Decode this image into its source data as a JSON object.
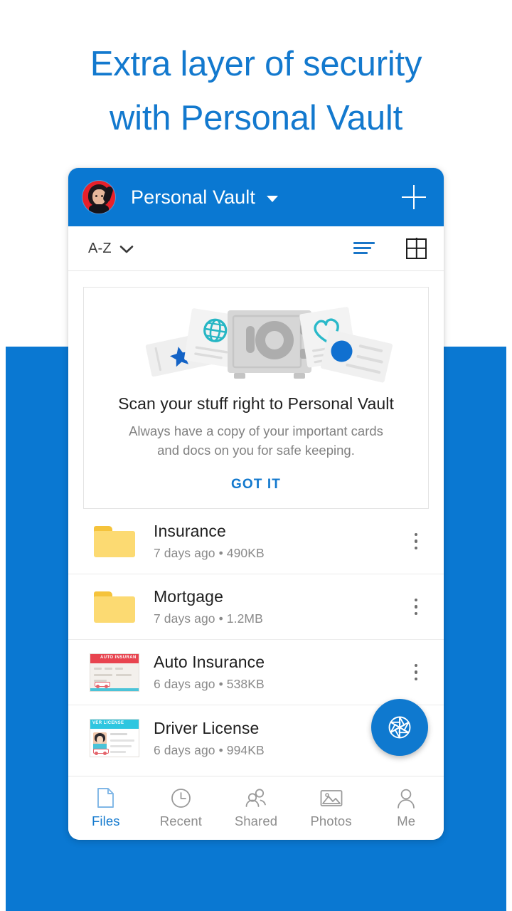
{
  "promo_banner": {
    "headline": "Extra layer of security\nwith Personal Vault",
    "headline_color": "#1379ce",
    "background_color": "#0a78d2"
  },
  "app": {
    "appbar": {
      "title": "Personal Vault",
      "avatar_name": "user-avatar",
      "dropdown_icon": "chevron-down-icon",
      "add_icon": "plus-icon",
      "background_color": "#0a78d2"
    },
    "sortbar": {
      "sort_label": "A-Z",
      "sort_caret_icon": "chevron-down-icon",
      "list_view_icon": "list-view-icon",
      "grid_view_icon": "grid-view-icon",
      "active_view": "list",
      "active_color": "#1a76c8"
    },
    "promo_card": {
      "title": "Scan your stuff right to Personal Vault",
      "subtitle": "Always have a copy of your important cards\nand docs on you for safe keeping.",
      "action_label": "GOT IT",
      "action_color": "#1379ce",
      "illustration": {
        "name": "personal-vault-safe-illustration",
        "safe_color": "#d6d6d6",
        "safe_detail_color": "#adadad",
        "card_color": "#f1f1f1",
        "badges": [
          {
            "name": "globe-icon",
            "color": "#26b6c4"
          },
          {
            "name": "star-icon",
            "color": "#1463c6"
          },
          {
            "name": "heart-icon",
            "color": "#2ab9c9"
          },
          {
            "name": "circle-icon",
            "color": "#1070d0"
          }
        ]
      }
    },
    "files": [
      {
        "name": "Insurance",
        "meta": "7 days ago • 490KB",
        "icon": "folder-icon",
        "type": "folder",
        "menu_icon": "kebab-menu-icon"
      },
      {
        "name": "Mortgage",
        "meta": "7 days ago • 1.2MB",
        "icon": "folder-icon",
        "type": "folder",
        "menu_icon": "kebab-menu-icon"
      },
      {
        "name": "Auto Insurance",
        "meta": "6 days ago • 538KB",
        "icon": "document-thumbnail",
        "type": "document",
        "thumbnail_label": "AUTO INSURAN",
        "thumbnail_band_color": "#e8444f",
        "thumbnail_foot_color": "#4bc3d8",
        "menu_icon": "kebab-menu-icon"
      },
      {
        "name": "Driver License",
        "meta": "6 days ago • 994KB",
        "icon": "document-thumbnail",
        "type": "document",
        "thumbnail_label": "VER LICENSE",
        "thumbnail_band_color": "#2ec6e0",
        "thumbnail_foot_color": "#ffffff",
        "menu_icon": "kebab-menu-icon"
      }
    ],
    "fab": {
      "icon": "camera-shutter-icon",
      "color": "#0f79cf"
    },
    "bottom_nav": {
      "active_index": 0,
      "active_color": "#1379ce",
      "items": [
        {
          "label": "Files",
          "icon": "document-icon"
        },
        {
          "label": "Recent",
          "icon": "clock-icon"
        },
        {
          "label": "Shared",
          "icon": "people-icon"
        },
        {
          "label": "Photos",
          "icon": "image-icon"
        },
        {
          "label": "Me",
          "icon": "person-icon"
        }
      ]
    }
  }
}
